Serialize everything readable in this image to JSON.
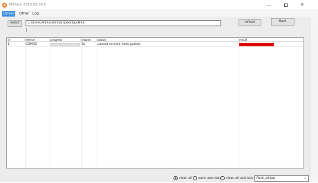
{
  "window": {
    "title": "MiFlash 2016.08.30.0",
    "min_glyph": "—",
    "close_glyph": "✕"
  },
  "menu": {
    "items": [
      {
        "label": "Driver",
        "active": true
      },
      {
        "label": "Other",
        "active": false
      },
      {
        "label": "Log",
        "active": false
      }
    ]
  },
  "toolbar": {
    "select_label": "select",
    "path_value": "C:\\Users\\Administrator\\Desktop\\MIUI",
    "refresh_label": "refresh",
    "flash_label": "flash"
  },
  "grid": {
    "columns": [
      "id",
      "device",
      "progress",
      "elapse",
      "status",
      "result"
    ],
    "rows": [
      {
        "id": "1",
        "device": "COM10",
        "progress": 0,
        "elapse": "3s",
        "status": "cannot receive hello packet",
        "result": "",
        "result_color": "#e00000"
      }
    ]
  },
  "footer": {
    "options": [
      {
        "label": "clean all",
        "checked": true
      },
      {
        "label": "save user data",
        "checked": false
      },
      {
        "label": "clean all and lock",
        "checked": false
      }
    ],
    "script_value": "flash_all.bat",
    "combo_arrow": "⌄"
  },
  "colors": {
    "menu_active": "#3c8ee0",
    "error_result": "#e00000",
    "app_icon": "#f07a1e"
  }
}
